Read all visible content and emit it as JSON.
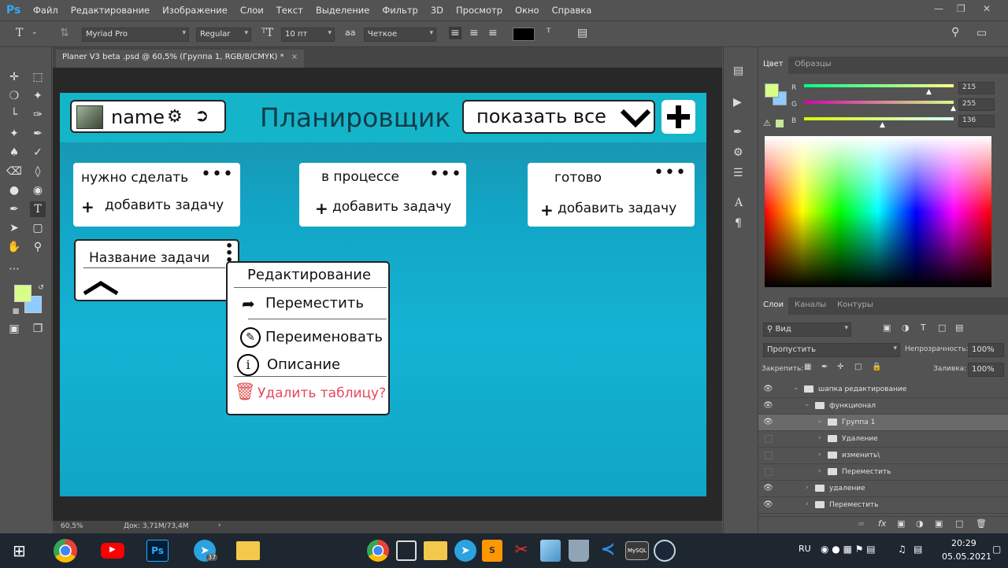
{
  "app": {
    "logo": "Ps"
  },
  "menu": [
    "Файл",
    "Редактирование",
    "Изображение",
    "Слои",
    "Текст",
    "Выделение",
    "Фильтр",
    "3D",
    "Просмотр",
    "Окно",
    "Справка"
  ],
  "options": {
    "font_family": "Myriad Pro",
    "font_style": "Regular",
    "font_size": "10 пт",
    "aa": "Четкое"
  },
  "document": {
    "tab_title": "Planer V3 beta .psd @ 60,5% (Группа 1, RGB/8/CMYK) *",
    "zoom": "60,5%",
    "doc_info": "Док: 3,71M/73,4M"
  },
  "design": {
    "user_name": "name",
    "app_title": "Планировщик",
    "filter_label": "показать все",
    "columns": [
      {
        "title": "нужно сделать",
        "add_label": "добавить задачу"
      },
      {
        "title": "в процессе",
        "add_label": "добавить задачу"
      },
      {
        "title": "готово",
        "add_label": "добавить задачу"
      }
    ],
    "task_title": "Название задачи",
    "menu": {
      "header": "Редактирование",
      "move": "Переместить",
      "rename": "Переименовать",
      "describe": "Описание",
      "delete": "Удалить таблицу?"
    }
  },
  "color_panel": {
    "tabs": [
      "Цвет",
      "Образцы"
    ],
    "r_label": "R",
    "g_label": "G",
    "b_label": "B",
    "r": "215",
    "g": "255",
    "b": "136",
    "fg_color": "#d7ff88",
    "bg_color": "#8ecbff"
  },
  "layers_panel": {
    "tabs": [
      "Слои",
      "Каналы",
      "Контуры"
    ],
    "search": "Вид",
    "blend": "Пропустить",
    "opacity_label": "Непрозрачность:",
    "opacity": "100%",
    "lock_label": "Закрепить:",
    "fill_label": "Заливка:",
    "fill": "100%",
    "layers": [
      {
        "name": "шапка редактирование",
        "visible": true,
        "indent": 0
      },
      {
        "name": "функционал",
        "visible": true,
        "indent": 1
      },
      {
        "name": "Группа 1",
        "visible": true,
        "indent": 2,
        "selected": true
      },
      {
        "name": "Удаление",
        "visible": false,
        "indent": 3
      },
      {
        "name": "изменить\\",
        "visible": false,
        "indent": 3
      },
      {
        "name": "Переместить",
        "visible": false,
        "indent": 3
      },
      {
        "name": "удаление",
        "visible": true,
        "indent": 1
      },
      {
        "name": "Переместить",
        "visible": true,
        "indent": 1
      }
    ]
  },
  "taskbar": {
    "lang": "RU",
    "time": "20:29",
    "date": "05.05.2021",
    "telegram_badge": "37"
  }
}
